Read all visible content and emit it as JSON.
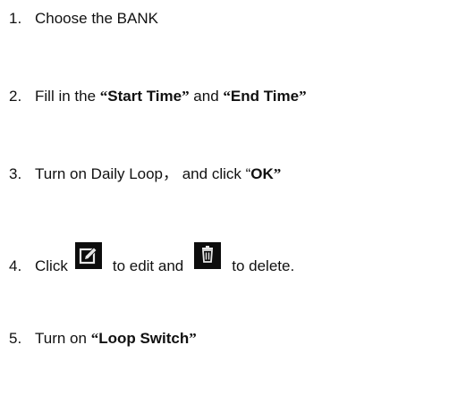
{
  "steps": [
    {
      "num": "1.",
      "text": "Choose the BANK"
    },
    {
      "num": "2.",
      "pre": "Fill in the ",
      "q_open_1": "“",
      "bold_1": "Start Time",
      "q_close_1": "”",
      "mid": " and ",
      "q_open_2": "“",
      "bold_2": "End Time",
      "q_close_2": "”"
    },
    {
      "num": "3.",
      "pre": "Turn on Daily Loop， and click “",
      "bold": "OK",
      "q_close": "”"
    },
    {
      "num": "4.",
      "pre": "Click",
      "edit_icon": "edit-icon",
      "mid": "to edit and",
      "delete_icon": "trash-icon",
      "post": "to delete."
    },
    {
      "num": "5.",
      "pre": "Turn on ",
      "q_open": "“",
      "bold": "Loop Switch",
      "q_close": "”"
    }
  ],
  "colors": {
    "text": "#111111",
    "icon_bg": "#0d0d0d",
    "icon_fg": "#e8e8e8"
  }
}
